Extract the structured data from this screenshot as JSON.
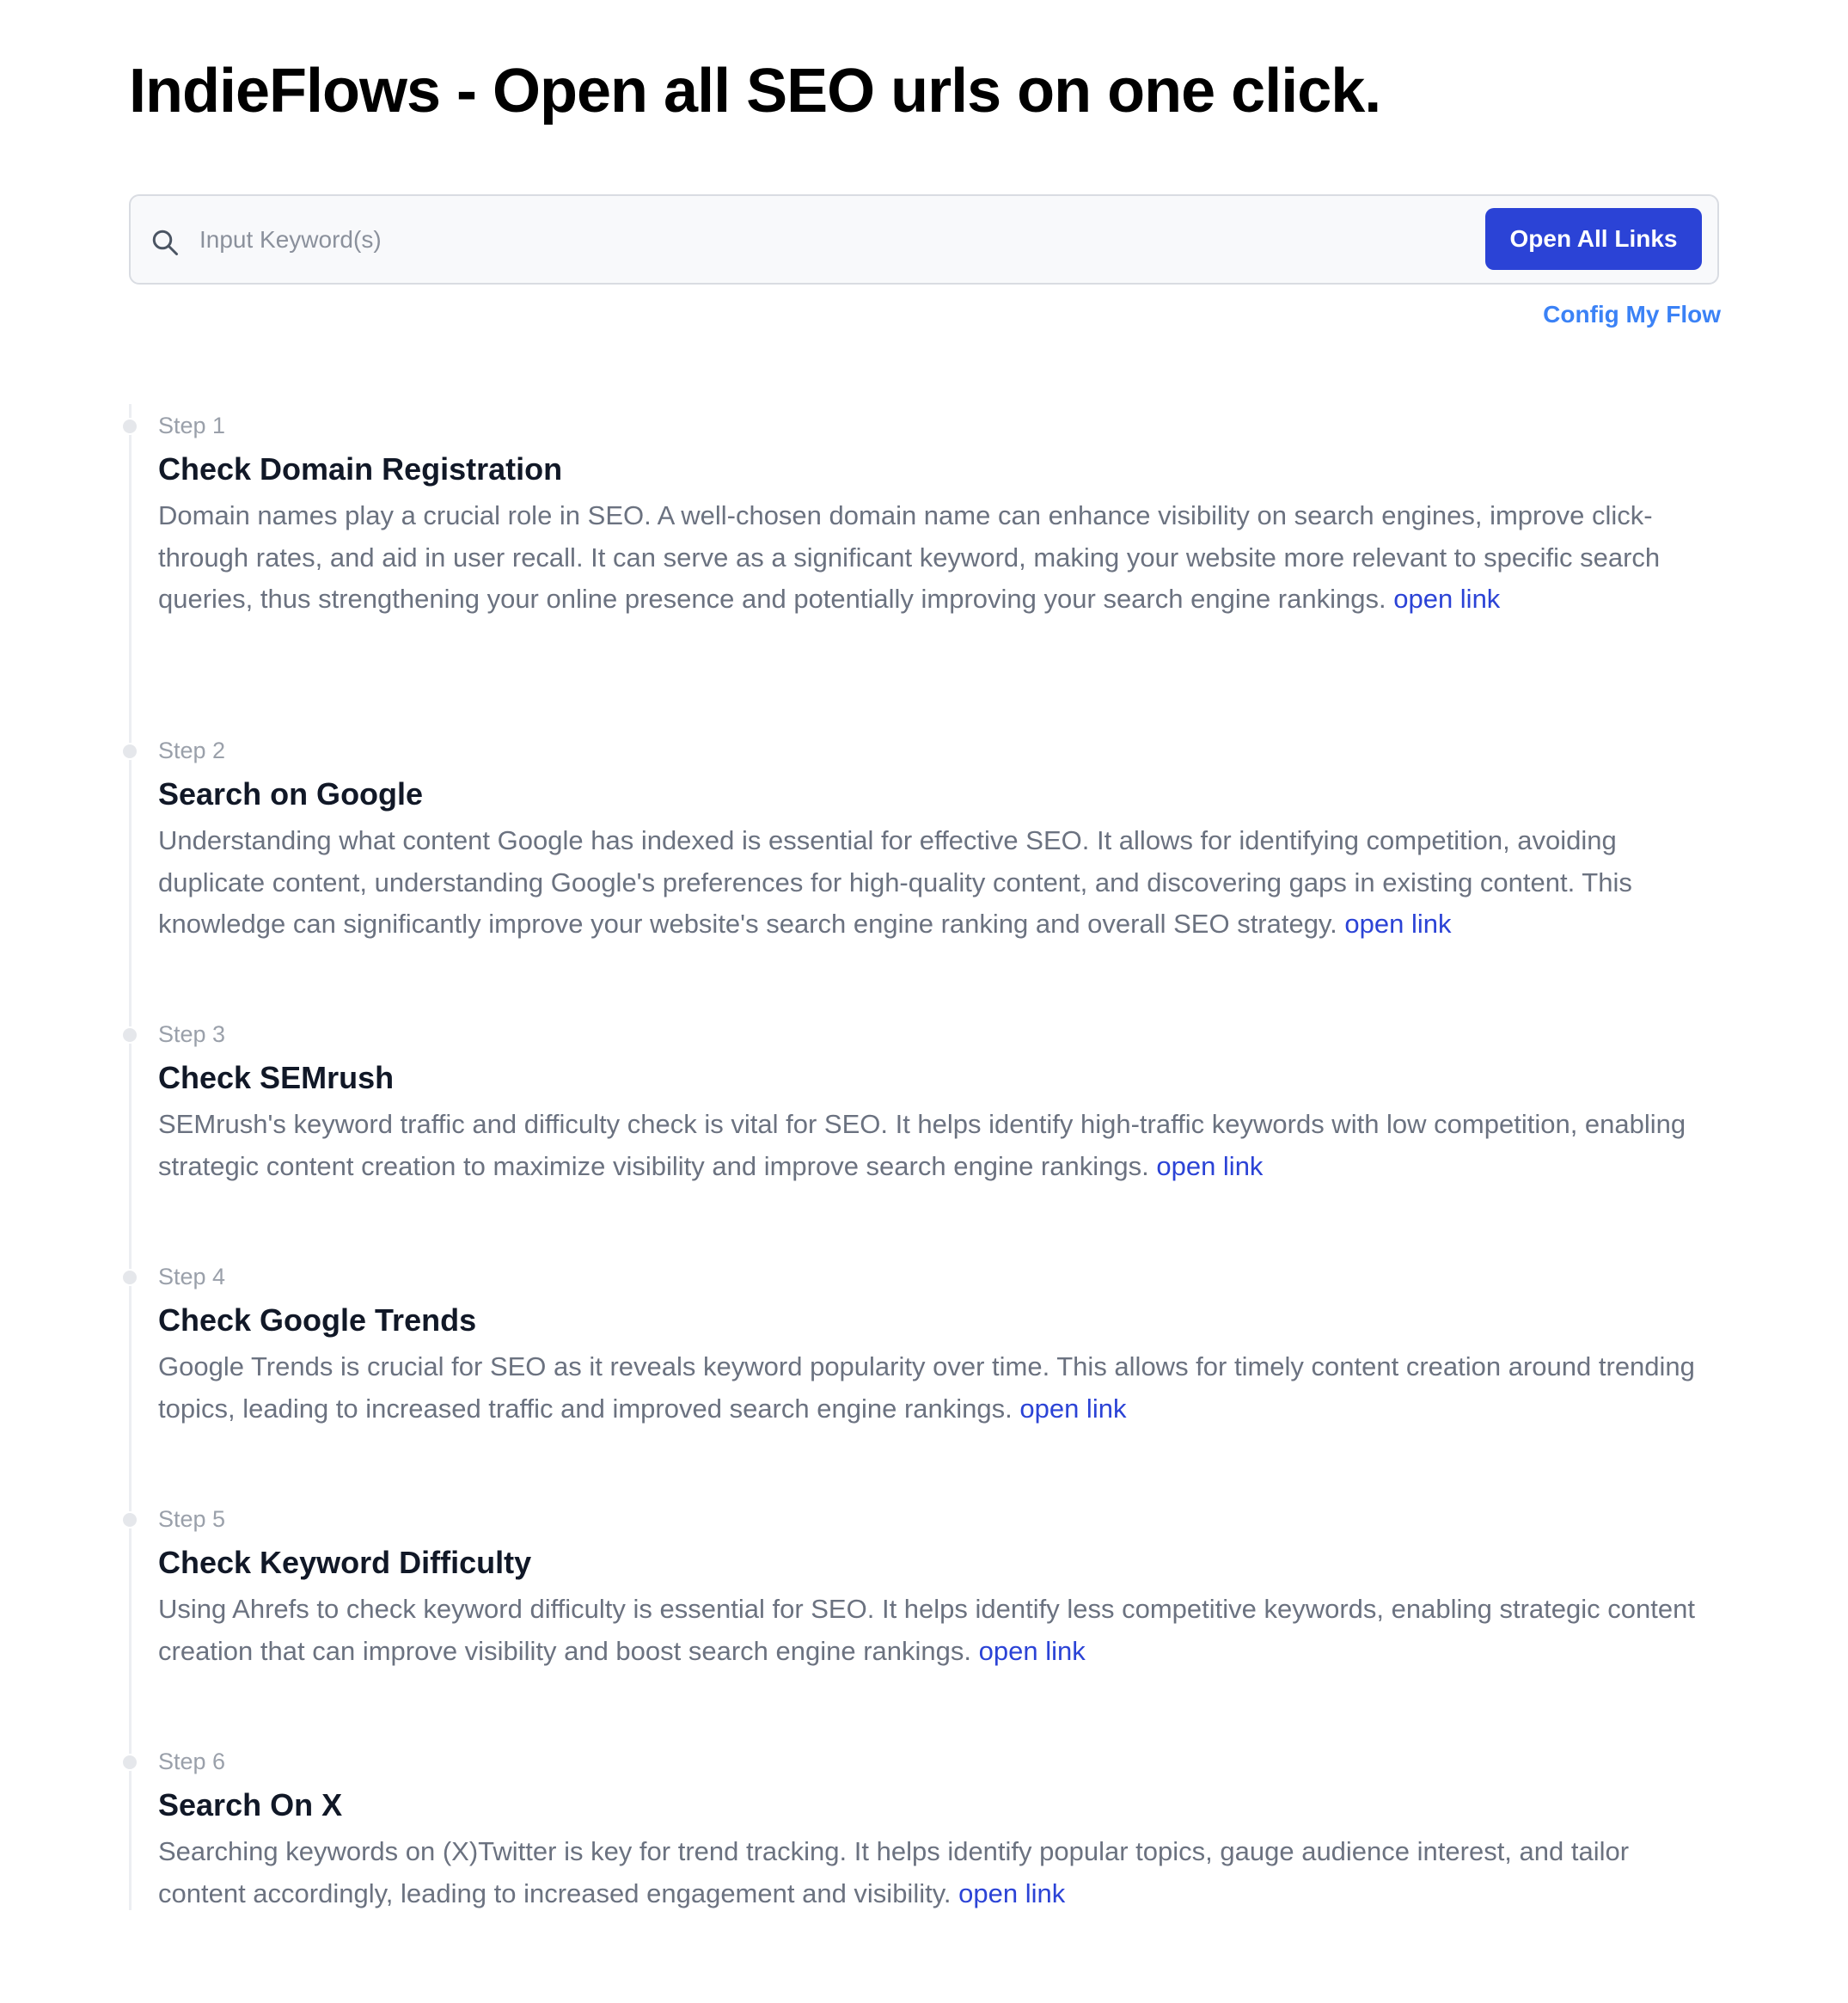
{
  "header": {
    "title": "IndieFlows - Open all SEO urls on one click."
  },
  "search": {
    "placeholder": "Input Keyword(s)",
    "value": "",
    "icon": "search-icon",
    "button_label": "Open All Links"
  },
  "config_link_label": "Config My Flow",
  "colors": {
    "accent": "#2b43d6",
    "config_link": "#3b82f6",
    "step_label": "#9aa0aa",
    "description": "#6b7280"
  },
  "steps": [
    {
      "label": "Step 1",
      "title": "Check Domain Registration",
      "description": "Domain names play a crucial role in SEO. A well-chosen domain name can enhance visibility on search engines, improve click-through rates, and aid in user recall. It can serve as a significant keyword, making your website more relevant to specific search queries, thus strengthening your online presence and potentially improving your search engine rankings.",
      "link_label": "open link"
    },
    {
      "label": "Step 2",
      "title": "Search on Google",
      "description": "Understanding what content Google has indexed is essential for effective SEO. It allows for identifying competition, avoiding duplicate content, understanding Google's preferences for high-quality content, and discovering gaps in existing content. This knowledge can significantly improve your website's search engine ranking and overall SEO strategy.",
      "link_label": "open link"
    },
    {
      "label": "Step 3",
      "title": "Check SEMrush",
      "description": "SEMrush's keyword traffic and difficulty check is vital for SEO. It helps identify high-traffic keywords with low competition, enabling strategic content creation to maximize visibility and improve search engine rankings.",
      "link_label": "open link"
    },
    {
      "label": "Step 4",
      "title": "Check Google Trends",
      "description": "Google Trends is crucial for SEO as it reveals keyword popularity over time. This allows for timely content creation around trending topics, leading to increased traffic and improved search engine rankings.",
      "link_label": "open link"
    },
    {
      "label": "Step 5",
      "title": "Check Keyword Difficulty",
      "description": "Using Ahrefs to check keyword difficulty is essential for SEO. It helps identify less competitive keywords, enabling strategic content creation that can improve visibility and boost search engine rankings.",
      "link_label": "open link"
    },
    {
      "label": "Step 6",
      "title": "Search On X",
      "description": "Searching keywords on (X)Twitter is key for trend tracking. It helps identify popular topics, gauge audience interest, and tailor content accordingly, leading to increased engagement and visibility.",
      "link_label": "open link"
    }
  ]
}
